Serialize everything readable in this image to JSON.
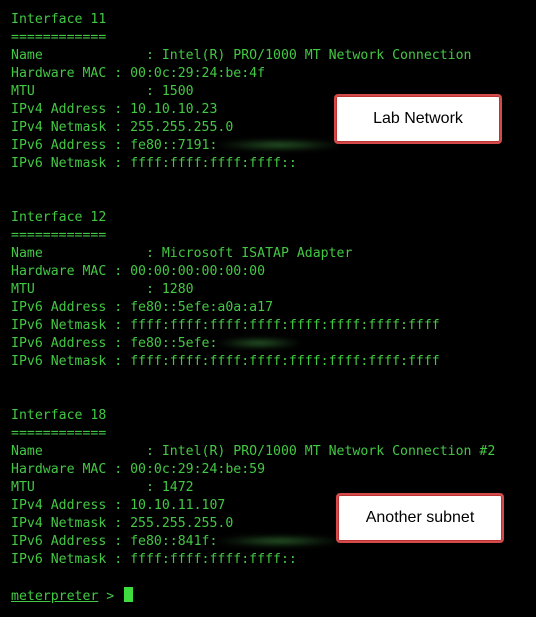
{
  "terminal": {
    "interfaces": [
      {
        "header": "Interface 11",
        "underline": "============",
        "rows": [
          "Name             : Intel(R) PRO/1000 MT Network Connection",
          "Hardware MAC : 00:0c:29:24:be:4f",
          "MTU              : 1500",
          "IPv4 Address : 10.10.10.23",
          "IPv4 Netmask : 255.255.255.0",
          "IPv6 Address : fe80::7191:",
          "IPv6 Netmask : ffff:ffff:ffff:ffff::"
        ]
      },
      {
        "header": "Interface 12",
        "underline": "============",
        "rows": [
          "Name             : Microsoft ISATAP Adapter",
          "Hardware MAC : 00:00:00:00:00:00",
          "MTU              : 1280",
          "IPv6 Address : fe80::5efe:a0a:a17",
          "IPv6 Netmask : ffff:ffff:ffff:ffff:ffff:ffff:ffff:ffff",
          "IPv6 Address : fe80::5efe:",
          "IPv6 Netmask : ffff:ffff:ffff:ffff:ffff:ffff:ffff:ffff"
        ]
      },
      {
        "header": "Interface 18",
        "underline": "============",
        "rows": [
          "Name             : Intel(R) PRO/1000 MT Network Connection #2",
          "Hardware MAC : 00:0c:29:24:be:59",
          "MTU              : 1472",
          "IPv4 Address : 10.10.11.107",
          "IPv4 Netmask : 255.255.255.0",
          "IPv6 Address : fe80::841f:",
          "IPv6 Netmask : ffff:ffff:ffff:ffff::"
        ]
      }
    ],
    "prompt": {
      "word": "meterpreter",
      "symbol": " > "
    }
  },
  "callouts": {
    "lab_network": "Lab Network",
    "another_subnet": "Another subnet"
  },
  "colors": {
    "background": "#000000",
    "text": "#43c843",
    "callout_border": "#d24a4a"
  }
}
